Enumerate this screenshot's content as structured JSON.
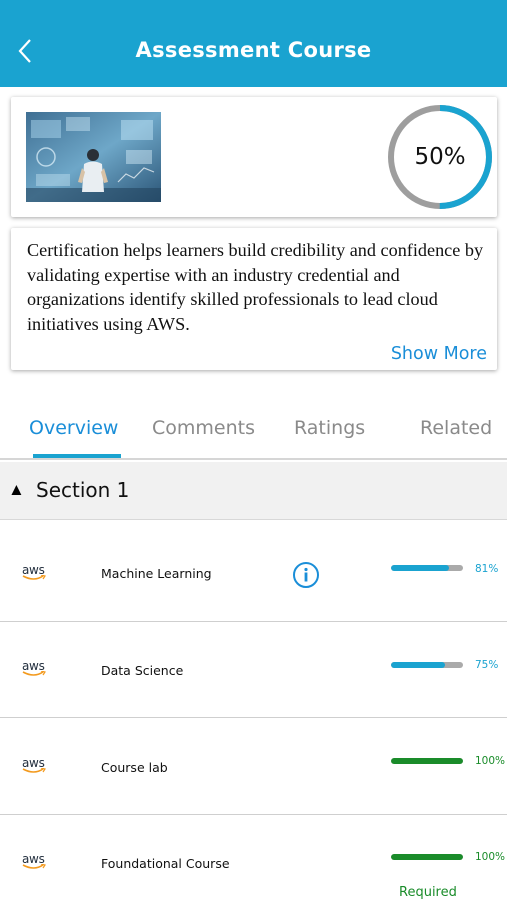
{
  "header": {
    "title": "Assessment Course",
    "back_icon": "chevron-left-icon"
  },
  "hero": {
    "progress_percent": 50,
    "progress_label": "50%",
    "image": "business-person-digital-dashboard"
  },
  "description": {
    "text": "Certification helps learners build credibility and confidence by validating expertise with an industry credential and organizations identify skilled professionals to lead cloud initiatives using AWS.",
    "show_more": "Show More"
  },
  "tabs": [
    {
      "label": "Overview",
      "active": true
    },
    {
      "label": "Comments",
      "active": false
    },
    {
      "label": "Ratings",
      "active": false
    },
    {
      "label": "Related",
      "active": false
    }
  ],
  "section": {
    "arrow": "▲",
    "label": "Section 1",
    "expanded": true
  },
  "courses": [
    {
      "logo": "aws",
      "name": "Machine Learning",
      "progress": 81,
      "progress_label": "81%",
      "has_info": true,
      "color": "#1aa3d0",
      "required": ""
    },
    {
      "logo": "aws",
      "name": "Data Science",
      "progress": 75,
      "progress_label": "75%",
      "has_info": false,
      "color": "#1aa3d0",
      "required": ""
    },
    {
      "logo": "aws",
      "name": "Course lab",
      "progress": 100,
      "progress_label": "100%",
      "has_info": false,
      "color": "#1a8c2a",
      "required": ""
    },
    {
      "logo": "aws",
      "name": "Foundational Course",
      "progress": 100,
      "progress_label": "100%",
      "has_info": false,
      "color": "#1a8c2a",
      "required": "Required"
    }
  ],
  "colors": {
    "header": "#1aa3d0",
    "accent": "#1a8ed8",
    "complete": "#1a8c2a",
    "track": "#aaaaaa"
  }
}
